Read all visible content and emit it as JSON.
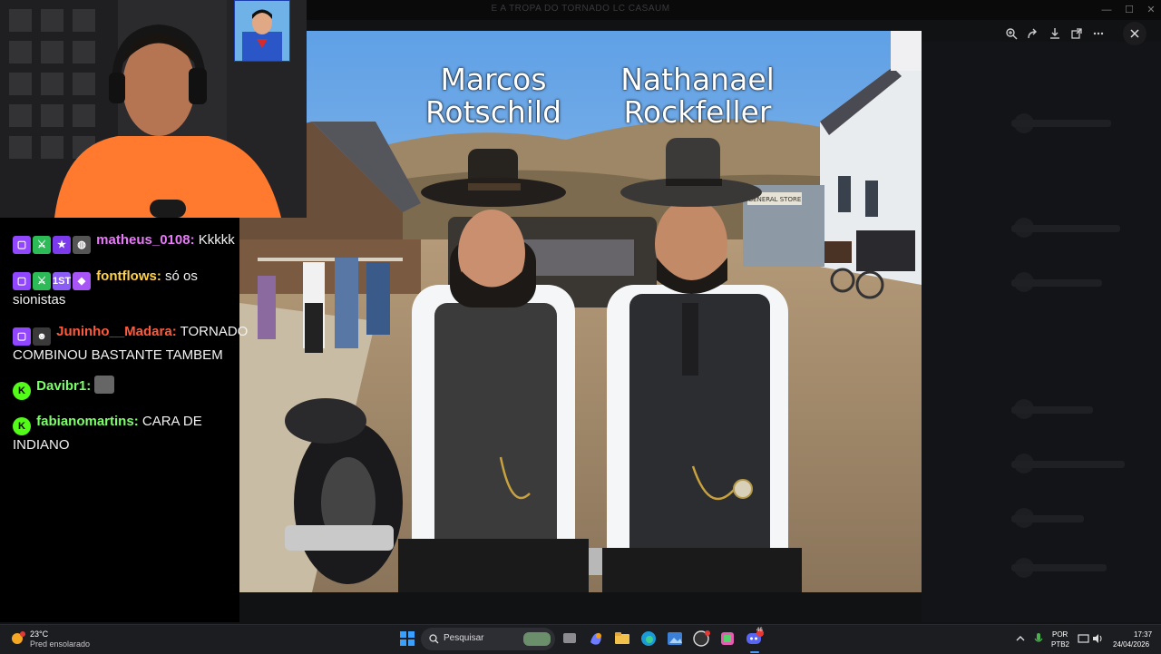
{
  "window": {
    "title": "E A TROPA DO TORNADO LC CASAUM"
  },
  "viewer_toolbar": {
    "icons": [
      "zoom-icon",
      "share-icon",
      "download-icon",
      "open-external-icon",
      "more-icon"
    ],
    "close_icon": "close-icon"
  },
  "photo": {
    "left_name": "Marcos\nRotschild",
    "right_name": "Nathanael\nRockfeller",
    "sign_text": "GENERAL STORE"
  },
  "chat": {
    "messages": [
      {
        "user": "matheus_0108:",
        "text": " Kkkkk",
        "color": "#e879f9"
      },
      {
        "user": "fontflows:",
        "text": " só os sionistas",
        "color": "#ffd24a"
      },
      {
        "user": "Juninho__Madara:",
        "text": " TORNADO COMBINOU BASTANTE TAMBEM",
        "color": "#ff5a3c"
      },
      {
        "user": "Davibr1:",
        "text": "",
        "color": "#7dff6a"
      },
      {
        "user": "fabianomartins:",
        "text": " CARA DE INDIANO",
        "color": "#7dff6a"
      }
    ],
    "badge_labels": {
      "sub_months": "1ST",
      "partner": "K"
    }
  },
  "taskbar": {
    "weather_temp": "23°C",
    "weather_desc": "Pred ensolarado",
    "search_placeholder": "Pesquisar",
    "lang_top": "POR",
    "lang_bottom": "PTB2",
    "time": "17:37",
    "date": "24/04/2026",
    "discord_badge": "46"
  },
  "colors": {
    "accent_twitch": "#9146ff",
    "accent_kick": "#53fc18"
  }
}
